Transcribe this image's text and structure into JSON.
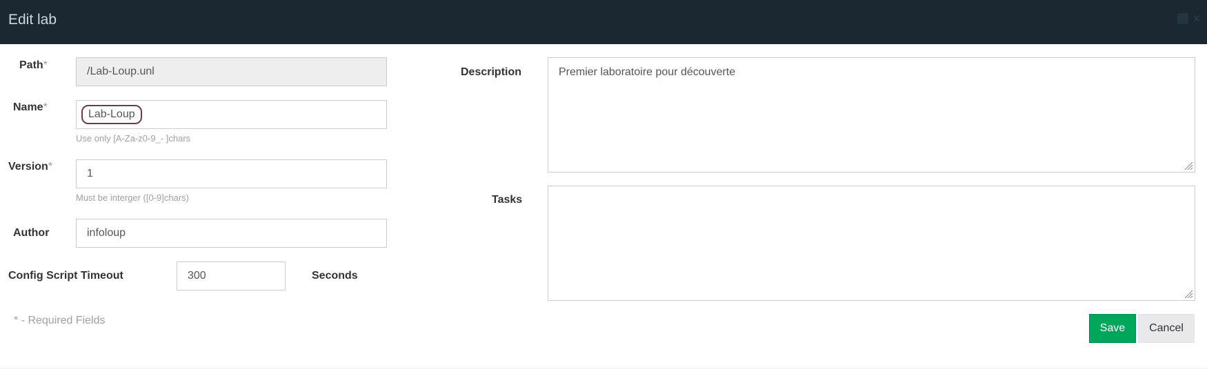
{
  "window": {
    "title": "Edit lab",
    "minimize_icon": "minimize-icon",
    "close_icon": "close-icon",
    "close_glyph": "×"
  },
  "form": {
    "required_mark": "*",
    "path": {
      "label": "Path",
      "value": "/Lab-Loup.unl"
    },
    "name": {
      "label": "Name",
      "value": "Lab-Loup",
      "help": "Use only [A-Za-z0-9_- ]chars"
    },
    "version": {
      "label": "Version",
      "value": "1",
      "help": "Must be interger ([0-9]chars)"
    },
    "author": {
      "label": "Author",
      "value": "infoloup"
    },
    "timeout": {
      "label": "Config Script Timeout",
      "value": "300",
      "unit": "Seconds"
    },
    "required_note": "* - Required Fields",
    "description": {
      "label": "Description",
      "value": "Premier laboratoire pour découverte"
    },
    "tasks": {
      "label": "Tasks",
      "value": ""
    }
  },
  "buttons": {
    "save_label": "Save",
    "cancel_label": "Cancel"
  },
  "colors": {
    "header_bg": "#1b2831",
    "save_bg": "#00a65a",
    "focus_ring": "#6d3b45"
  }
}
